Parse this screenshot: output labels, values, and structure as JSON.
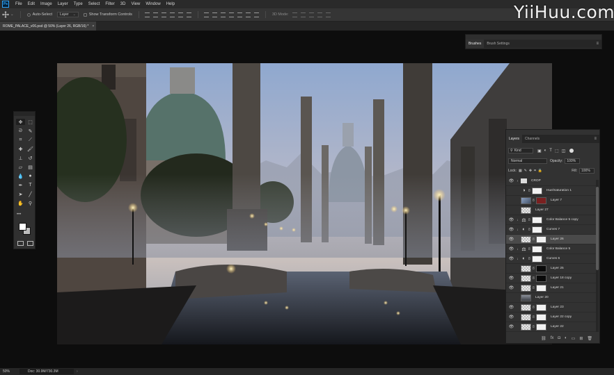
{
  "app": {
    "logo": "Ps",
    "menu": [
      "File",
      "Edit",
      "Image",
      "Layer",
      "Type",
      "Select",
      "Filter",
      "3D",
      "View",
      "Window",
      "Help"
    ]
  },
  "options_bar": {
    "auto_select_label": "Auto-Select",
    "auto_select_value": "Layer",
    "transform_controls_label": "Show Transform Controls",
    "mode_label": "3D Mode:"
  },
  "document_tab": {
    "title": "ROME_PALACE_v06.psd @ 50% (Layer 26, RGB/16) *",
    "close": "×"
  },
  "tools": {
    "icons": [
      "move-tool",
      "marquee-tool",
      "lasso-tool",
      "quick-select-tool",
      "crop-tool",
      "eyedropper-tool",
      "healing-tool",
      "brush-tool",
      "stamp-tool",
      "history-brush-tool",
      "eraser-tool",
      "gradient-tool",
      "blur-tool",
      "dodge-tool",
      "pen-tool",
      "type-tool",
      "path-select-tool",
      "line-tool",
      "hand-tool",
      "zoom-tool"
    ],
    "more": "•••",
    "foreground_color": "#ffffff",
    "background_color": "#bdbdbd"
  },
  "brushes_panel": {
    "tabs": [
      "Brushes",
      "Brush Settings"
    ]
  },
  "layers_panel": {
    "tabs": [
      "Layers",
      "Channels"
    ],
    "filter_label": "Kind",
    "blend_mode": "Normal",
    "opacity_label": "Opacity:",
    "opacity_value": "100%",
    "lock_label": "Lock:",
    "fill_label": "Fill:",
    "fill_value": "100%",
    "layers": [
      {
        "name": "CROP",
        "kind": "group",
        "visible": true,
        "selected": false
      },
      {
        "name": "Hue/Saturation 1",
        "kind": "adjustment",
        "visible": false,
        "selected": false
      },
      {
        "name": "Layer 7",
        "kind": "image",
        "visible": false,
        "selected": false
      },
      {
        "name": "Layer 27",
        "kind": "pixel",
        "visible": false,
        "selected": false
      },
      {
        "name": "Color Balance 5 copy",
        "kind": "adjustment",
        "visible": true,
        "selected": false
      },
      {
        "name": "Curves 7",
        "kind": "adjustment",
        "visible": true,
        "selected": false
      },
      {
        "name": "Layer 26",
        "kind": "pixel-mask",
        "visible": true,
        "selected": true
      },
      {
        "name": "Color Balance 5",
        "kind": "adjustment",
        "visible": true,
        "selected": false
      },
      {
        "name": "Curves 6",
        "kind": "adjustment",
        "visible": true,
        "selected": false
      },
      {
        "name": "Layer 25",
        "kind": "pixel-black",
        "visible": false,
        "selected": false
      },
      {
        "name": "Layer 18 copy",
        "kind": "pixel-mask",
        "visible": true,
        "selected": false
      },
      {
        "name": "Layer 21",
        "kind": "pixel-mask",
        "visible": true,
        "selected": false
      },
      {
        "name": "Layer 20",
        "kind": "image",
        "visible": false,
        "selected": false
      },
      {
        "name": "Layer 23",
        "kind": "pixel-mask",
        "visible": true,
        "selected": false
      },
      {
        "name": "Layer 22 copy",
        "kind": "pixel-mask",
        "visible": true,
        "selected": false
      },
      {
        "name": "Layer 22",
        "kind": "pixel-mask",
        "visible": true,
        "selected": false
      }
    ],
    "footer_icons": [
      "link-icon",
      "fx-icon",
      "mask-icon",
      "adjustment-icon",
      "folder-icon",
      "new-layer-icon",
      "trash-icon"
    ],
    "footer_fx": "fx"
  },
  "status_bar": {
    "zoom": "50%",
    "doc": "Doc: 30.9M/730.3M"
  },
  "watermark": "YiiHuu.com",
  "colors": {
    "menubar": "#2a2a2a",
    "panel": "#323232",
    "selected_layer": "#4a4a4a",
    "accent": "#31a8ff"
  }
}
